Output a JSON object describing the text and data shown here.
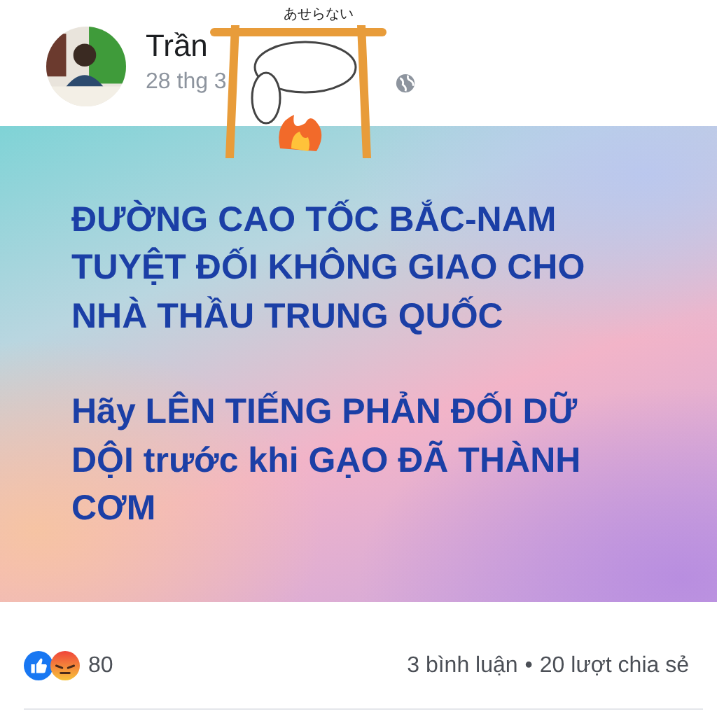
{
  "post": {
    "author": "Trần",
    "date": "28 thg 3",
    "sticker": {
      "caption": "あせらない"
    },
    "message": [
      "ĐƯỜNG CAO TỐC BẮC-NAM TUYỆT ĐỐI KHÔNG GIAO CHO NHÀ THẦU TRUNG QUỐC",
      "Hãy LÊN TIẾNG PHẢN ĐỐI DỮ DỘI trước khi GẠO ĐÃ THÀNH CƠM"
    ],
    "reactions": {
      "count": "80"
    },
    "comments": "3 bình luận",
    "separator": "•",
    "shares": "20 lượt chia sẻ"
  }
}
